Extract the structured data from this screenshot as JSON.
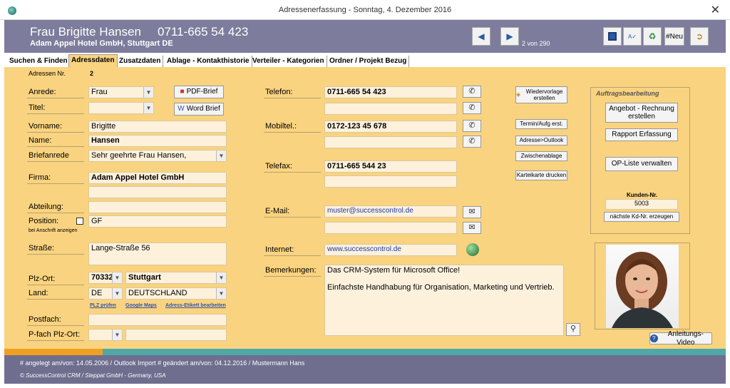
{
  "window": {
    "title": "Adressenerfassung - Sonntag, 4. Dezember 2016",
    "close": "✕"
  },
  "header": {
    "name": "Frau Brigitte Hansen",
    "phone": "0711-665 54 423",
    "company_line": "Adam Appel Hotel GmbH, Stuttgart  DE",
    "record_count": "2 von 290",
    "new_label": "#Neu"
  },
  "tabs": [
    {
      "label": "Suchen & Finden"
    },
    {
      "label": "Adressdaten"
    },
    {
      "label": "Zusatzdaten"
    },
    {
      "label": "Ablage - Kontakthistorie"
    },
    {
      "label": "Verteiler - Kategorien"
    },
    {
      "label": "Ordner / Projekt Bezug"
    }
  ],
  "form": {
    "adressen_nr_label": "Adressen Nr.",
    "adressen_nr": "2",
    "anrede_label": "Anrede:",
    "anrede": "Frau",
    "titel_label": "Titel:",
    "titel": "",
    "vorname_label": "Vorname:",
    "vorname": "Brigitte",
    "name_label": "Name:",
    "name": "Hansen",
    "briefanrede_label": "Briefanrede",
    "briefanrede": "Sehr geehrte Frau Hansen,",
    "firma_label": "Firma:",
    "firma": "Adam Appel Hotel GmbH",
    "firma2": "",
    "abteilung_label": "Abteilung:",
    "abteilung": "",
    "position_label": "Position:",
    "position": "GF",
    "position_note": "bei Anschrift anzeigen",
    "strasse_label": "Straße:",
    "strasse": "Lange-Straße 56",
    "plzort_label": "Plz-Ort:",
    "plz": "70332",
    "ort": "Stuttgart",
    "land_label": "Land:",
    "land_code": "DE",
    "land": "DEUTSCHLAND",
    "link_plz": "PLZ prüfen",
    "link_maps": "Google Maps",
    "link_etikett": "Adress-Etikett bearbeiten",
    "postfach_label": "Postfach:",
    "postfach": "",
    "pfach_plzort_label": "P-fach Plz-Ort:",
    "pfach_plz": "",
    "pfach_ort": "",
    "telefon_label": "Telefon:",
    "telefon": "0711-665 54 423",
    "telefon2": "",
    "mobil_label": "Mobiltel.:",
    "mobil": "0172-123 45 678",
    "mobil2": "",
    "telefax_label": "Telefax:",
    "telefax": "0711-665 544 23",
    "telefax2": "",
    "email_label": "E-Mail:",
    "email": "muster@successcontrol.de",
    "email2": "",
    "internet_label": "Internet:",
    "internet": "www.successcontrol.de",
    "bemerkungen_label": "Bemerkungen:",
    "bemerkungen_line1": "Das CRM-System für Microsoft Office!",
    "bemerkungen_line2": "Einfachste Handhabung für Organisation, Marketing und Vertrieb."
  },
  "buttons": {
    "pdf_brief": "PDF-Brief",
    "word_brief": "Word Brief",
    "wiedervorlage": "Wiedervorlage erstellen",
    "termin": "Termin/Aufg erst.",
    "adresse_outlook": "Adresse>Outlook",
    "zwischenablage": "Zwischenablage",
    "karteikarte": "Karteikarte drucken",
    "angebot": "Angebot - Rechnung erstellen",
    "rapport": "Rapport Erfassung",
    "op_liste": "OP-Liste verwalten",
    "kd_nr_erzeugen": "nächste Kd-Nr. erzeugen",
    "anleitung": "Anleitungs-Video"
  },
  "auftrag": {
    "title": "Auftragsbearbeitung",
    "kunden_nr_label": "Kunden-Nr.",
    "kunden_nr": "5003"
  },
  "footer": {
    "stamp": "# angelegt am/von: 14.05.2006 / Outlook Import # geändert am/von: 04.12.2016 / Mustermann Hans",
    "copyright": "© SuccessControl CRM / Steppat GmbH - Germany, USA"
  },
  "colors": {
    "panel": "#f9d37f",
    "header": "#7d7c9c",
    "footer": "#6f6e8e",
    "field": "#fdf1dc",
    "status_teal": "#4ea8a8",
    "status_orange": "#f0a020"
  },
  "icons": [
    "app-icon",
    "arrow-left-icon",
    "arrow-right-icon",
    "save-icon",
    "spellcheck-icon",
    "recycle-icon",
    "exit-icon",
    "pdf-icon",
    "word-icon",
    "phone-icon",
    "email-icon",
    "globe-icon",
    "magnifier-icon",
    "help-icon",
    "bell-icon"
  ]
}
